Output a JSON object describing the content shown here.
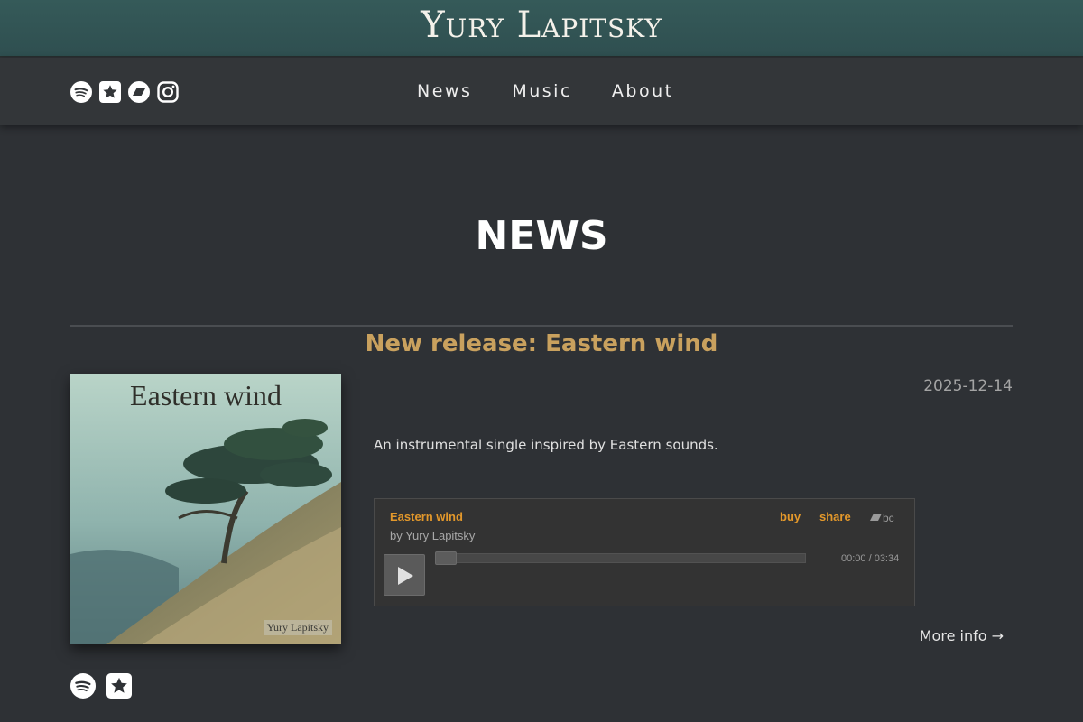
{
  "site": {
    "title": "Yury Lapitsky"
  },
  "social_links": [
    {
      "icon": "spotify-icon"
    },
    {
      "icon": "star-icon"
    },
    {
      "icon": "bandcamp-icon"
    },
    {
      "icon": "instagram-icon"
    }
  ],
  "nav": {
    "items": [
      {
        "label": "News"
      },
      {
        "label": "Music"
      },
      {
        "label": "About"
      }
    ]
  },
  "page": {
    "title": "NEWS"
  },
  "post": {
    "title": "New release: Eastern wind",
    "date": "2025-12-14",
    "description": "An instrumental single inspired by Eastern sounds.",
    "cover": {
      "title": "Eastern wind",
      "artist": "Yury Lapitsky"
    },
    "player": {
      "track": "Eastern wind",
      "artist": "by Yury Lapitsky",
      "buy_label": "buy",
      "share_label": "share",
      "time": "00:00 / 03:34",
      "progress": 0,
      "accent_color": "#e3982b"
    },
    "more_info": "More info →",
    "links": [
      {
        "icon": "spotify-icon"
      },
      {
        "icon": "star-icon"
      }
    ]
  },
  "colors": {
    "banner": "#2f4f50",
    "background": "#2e3135",
    "accent": "#c9a15e"
  }
}
